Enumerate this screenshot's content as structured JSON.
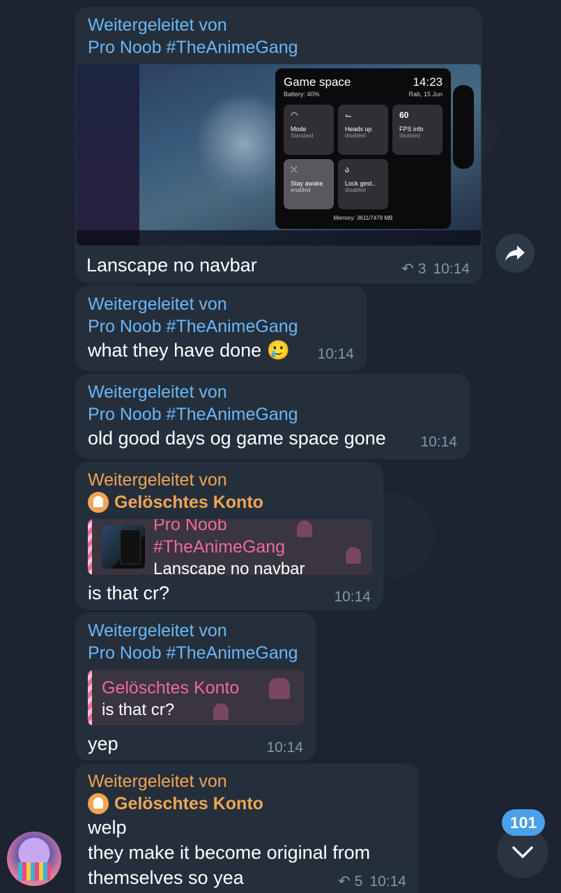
{
  "messages": [
    {
      "forward_label": "Weitergeleitet von",
      "forward_from": "Pro Noob #TheAnimeGang",
      "image": {
        "panel_title": "Game space",
        "clock": "14:23",
        "battery": "Battery: 40%",
        "date": "Rab, 15 Jun",
        "tiles": [
          {
            "icon": "◠",
            "name": "Mode",
            "state": "Standard"
          },
          {
            "icon": "⌙",
            "name": "Heads up",
            "state": "disabled"
          },
          {
            "icon": "60",
            "name": "FPS info",
            "state": "disabled"
          },
          {
            "icon": "⤫",
            "name": "Stay awake",
            "state": "enabled"
          },
          {
            "icon": "ა",
            "name": "Lock gest..",
            "state": "disabled"
          }
        ],
        "memory": "Memory: 3611/7479 MB"
      },
      "text": "Lanscape no navbar",
      "replies": "3",
      "time": "10:14"
    },
    {
      "forward_label": "Weitergeleitet von",
      "forward_from": "Pro Noob #TheAnimeGang",
      "text": "what they have done 🥲",
      "time": "10:14"
    },
    {
      "forward_label": "Weitergeleitet von",
      "forward_from": "Pro Noob #TheAnimeGang",
      "text": "old good days og game space gone",
      "time": "10:14"
    },
    {
      "forward_label": "Weitergeleitet von",
      "forward_from": "Gelöschtes Konto",
      "quote_title": "Pro Noob #TheAnimeGang",
      "quote_text": "Lanscape no navbar",
      "text": "is that cr?",
      "time": "10:14"
    },
    {
      "forward_label": "Weitergeleitet von",
      "forward_from": "Pro Noob #TheAnimeGang",
      "quote_title": "Gelöschtes Konto",
      "quote_text": "is that cr?",
      "text": "yep",
      "time": "10:14"
    },
    {
      "forward_label": "Weitergeleitet von",
      "forward_from": "Gelöschtes Konto",
      "lines": [
        "welp",
        "they make it become original from",
        "themselves so yea"
      ],
      "replies": "5",
      "time": "10:14"
    }
  ],
  "unread_badge": "101",
  "icons": {
    "share": "share-icon",
    "scroll_down": "chevron-down-icon",
    "reply": "reply-icon"
  },
  "colors": {
    "background": "#1b2430",
    "bubble": "#252f3c",
    "forward_blue": "#6cb6f5",
    "forward_orange": "#f0a552",
    "quote_pink": "#ef6b9a",
    "badge": "#4aa1ea"
  }
}
